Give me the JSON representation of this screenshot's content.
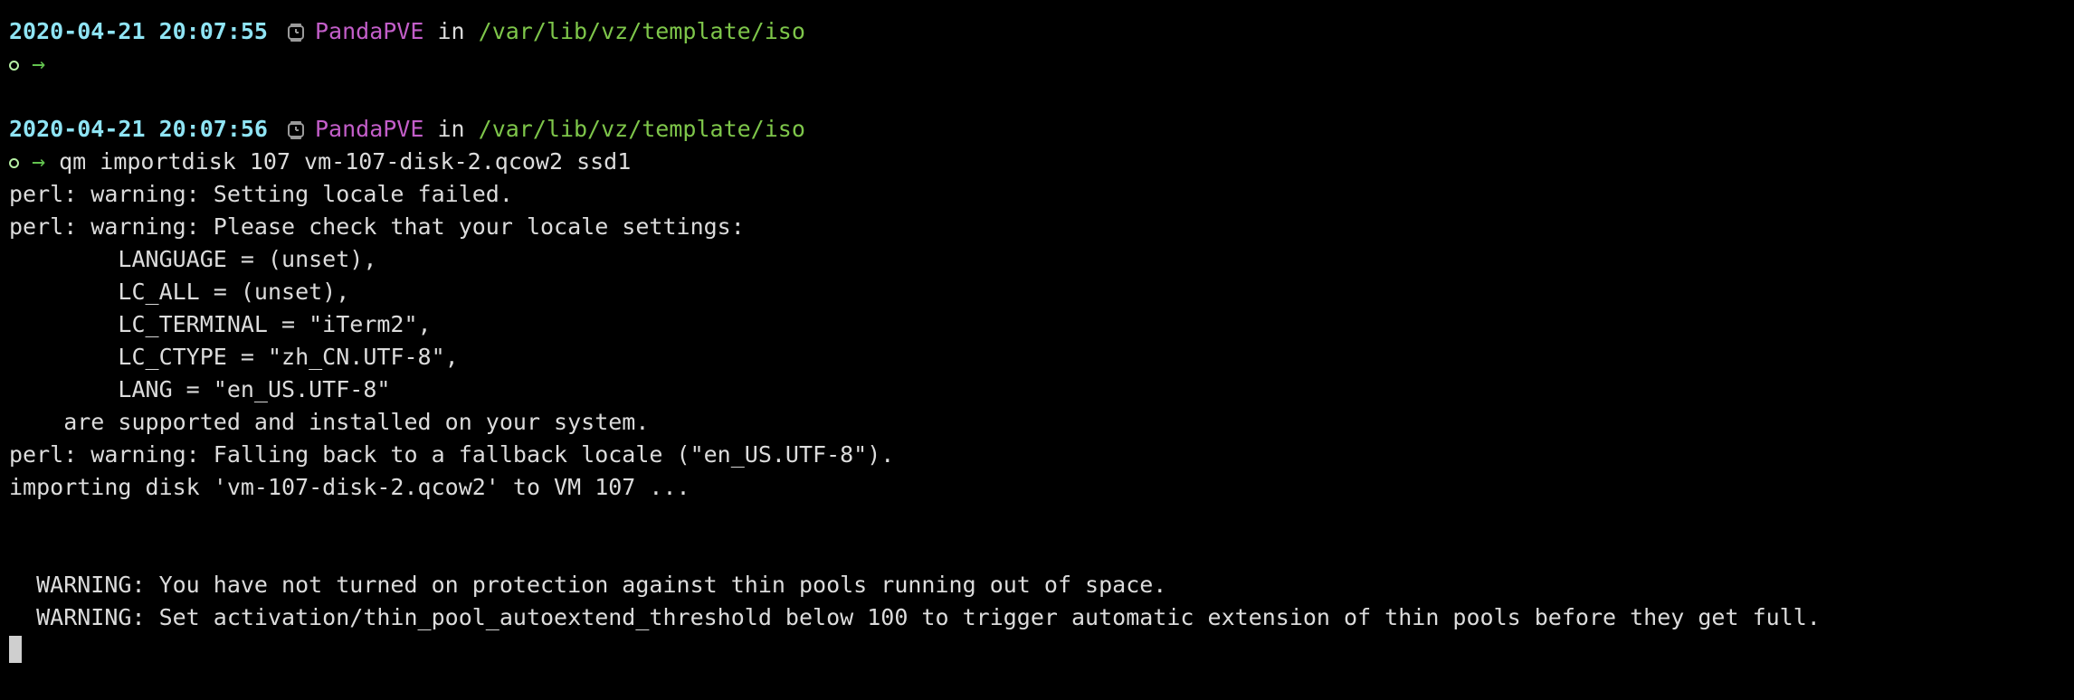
{
  "prompt1": {
    "timestamp": "2020-04-21 20:07:55",
    "clock_icon": "clock-icon",
    "host": "PandaPVE",
    "in_word": "in",
    "path": "/var/lib/vz/template/iso",
    "arrow": "→",
    "command": ""
  },
  "prompt2": {
    "timestamp": "2020-04-21 20:07:56",
    "clock_icon": "clock-icon",
    "host": "PandaPVE",
    "in_word": "in",
    "path": "/var/lib/vz/template/iso",
    "arrow": "→",
    "command": "qm importdisk 107 vm-107-disk-2.qcow2 ssd1"
  },
  "output": [
    "perl: warning: Setting locale failed.",
    "perl: warning: Please check that your locale settings:",
    "        LANGUAGE = (unset),",
    "        LC_ALL = (unset),",
    "        LC_TERMINAL = \"iTerm2\",",
    "        LC_CTYPE = \"zh_CN.UTF-8\",",
    "        LANG = \"en_US.UTF-8\"",
    "    are supported and installed on your system.",
    "perl: warning: Falling back to a fallback locale (\"en_US.UTF-8\").",
    "importing disk 'vm-107-disk-2.qcow2' to VM 107 ..."
  ],
  "warnings": [
    "  WARNING: You have not turned on protection against thin pools running out of space.",
    "  WARNING: Set activation/thin_pool_autoextend_threshold below 100 to trigger automatic extension of thin pools before they get full."
  ],
  "colors": {
    "background": "#000000",
    "timestamp": "#8fe4f4",
    "host": "#c35ec9",
    "path": "#7ec64a",
    "arrow": "#63c34f",
    "text": "#dcdcdc"
  }
}
